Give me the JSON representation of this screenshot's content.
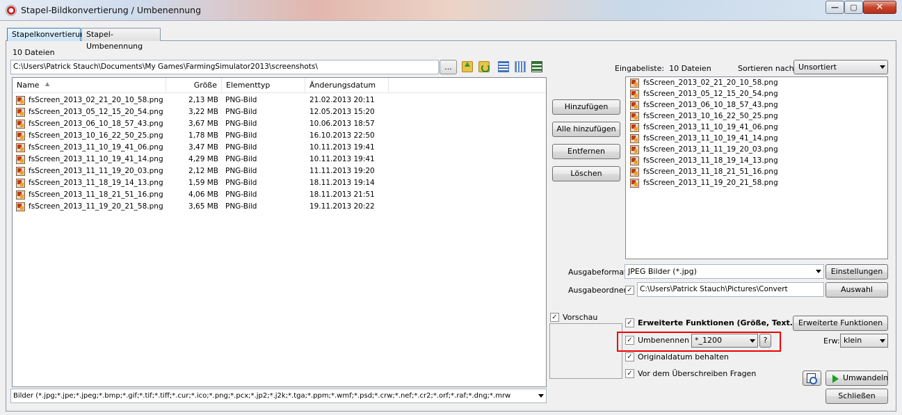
{
  "window": {
    "title": "Stapel-Bildkonvertierung / Umbenennung",
    "min": "—",
    "max": "▢",
    "close": "✕"
  },
  "tabs": [
    {
      "label": "Stapelkonvertierung"
    },
    {
      "label": "Stapel-Umbenennung"
    }
  ],
  "left": {
    "count": "10 Dateien",
    "path": "C:\\Users\\Patrick Stauch\\Documents\\My Games\\FarmingSimulator2013\\screenshots\\",
    "browse": "...",
    "columns": {
      "name": "Name",
      "size": "Größe",
      "type": "Elementtyp",
      "date": "Änderungsdatum"
    },
    "files": [
      {
        "name": "fsScreen_2013_02_21_20_10_58.png",
        "size": "2,13 MB",
        "type": "PNG-Bild",
        "date": "21.02.2013 20:11"
      },
      {
        "name": "fsScreen_2013_05_12_15_20_54.png",
        "size": "3,22 MB",
        "type": "PNG-Bild",
        "date": "12.05.2013 15:20"
      },
      {
        "name": "fsScreen_2013_06_10_18_57_43.png",
        "size": "3,67 MB",
        "type": "PNG-Bild",
        "date": "10.06.2013 18:57"
      },
      {
        "name": "fsScreen_2013_10_16_22_50_25.png",
        "size": "1,78 MB",
        "type": "PNG-Bild",
        "date": "16.10.2013 22:50"
      },
      {
        "name": "fsScreen_2013_11_10_19_41_06.png",
        "size": "3,47 MB",
        "type": "PNG-Bild",
        "date": "10.11.2013 19:41"
      },
      {
        "name": "fsScreen_2013_11_10_19_41_14.png",
        "size": "4,29 MB",
        "type": "PNG-Bild",
        "date": "10.11.2013 19:41"
      },
      {
        "name": "fsScreen_2013_11_11_19_20_03.png",
        "size": "2,12 MB",
        "type": "PNG-Bild",
        "date": "11.11.2013 19:20"
      },
      {
        "name": "fsScreen_2013_11_18_19_14_13.png",
        "size": "1,59 MB",
        "type": "PNG-Bild",
        "date": "18.11.2013 19:14"
      },
      {
        "name": "fsScreen_2013_11_18_21_51_16.png",
        "size": "4,06 MB",
        "type": "PNG-Bild",
        "date": "18.11.2013 21:51"
      },
      {
        "name": "fsScreen_2013_11_19_20_21_58.png",
        "size": "3,65 MB",
        "type": "PNG-Bild",
        "date": "19.11.2013 20:22"
      }
    ],
    "filter": "Bilder (*.jpg;*.jpe;*.jpeg;*.bmp;*.gif;*.tif;*.tiff;*.cur;*.ico;*.png;*.pcx;*.jp2;*.j2k;*.tga;*.ppm;*.wmf;*.psd;*.crw;*.nef;*.cr2;*.orf;*.raf;*.dng;*.mrw"
  },
  "middle": {
    "add": "Hinzufügen",
    "add_all": "Alle hinzufügen",
    "remove": "Entfernen",
    "clear": "Löschen"
  },
  "right": {
    "input_label": "Eingabeliste:",
    "input_count": "10 Dateien",
    "sort_label": "Sortieren nach:",
    "sort_value": "Unsortiert",
    "input_files": [
      "fsScreen_2013_02_21_20_10_58.png",
      "fsScreen_2013_05_12_15_20_54.png",
      "fsScreen_2013_06_10_18_57_43.png",
      "fsScreen_2013_10_16_22_50_25.png",
      "fsScreen_2013_11_10_19_41_06.png",
      "fsScreen_2013_11_10_19_41_14.png",
      "fsScreen_2013_11_11_19_20_03.png",
      "fsScreen_2013_11_18_19_14_13.png",
      "fsScreen_2013_11_18_21_51_16.png",
      "fsScreen_2013_11_19_20_21_58.png"
    ],
    "format_label": "Ausgabeformat:",
    "format_value": "JPEG Bilder (*.jpg)",
    "settings": "Einstellungen",
    "outdir_label": "Ausgabeordner:",
    "outdir_value": "C:\\Users\\Patrick Stauch\\Pictures\\Convert",
    "choose": "Auswahl",
    "preview_label": "Vorschau",
    "ext_label": "Erweiterte Funktionen (Größe, Text...)",
    "ext_button": "Erweiterte Funktionen",
    "rename_label": "Umbenennen",
    "rename_value": "*_1200",
    "help": "?",
    "erw_label": "Erw:",
    "erw_value": "klein",
    "orig_label": "Originaldatum behalten",
    "overwrite_label": "Vor dem Überschreiben Fragen",
    "convert": "Umwandeln",
    "close": "Schließen",
    "check": "✓"
  }
}
